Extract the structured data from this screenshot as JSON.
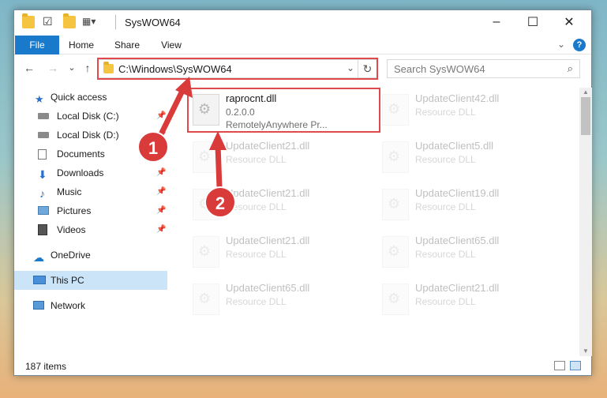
{
  "window": {
    "title": "SysWOW64",
    "minimize": "–",
    "maximize": "☐",
    "close": "✕"
  },
  "ribbon": {
    "tabs": [
      "File",
      "Home",
      "Share",
      "View"
    ],
    "expand_icon": "⌄",
    "help_icon": "?"
  },
  "navbar": {
    "back": "←",
    "forward": "→",
    "recent": "⌄",
    "up": "↑",
    "address": "C:\\Windows\\SysWOW64",
    "address_dropdown": "⌄",
    "refresh": "↻",
    "search_placeholder": "Search SysWOW64",
    "search_icon": "⌕"
  },
  "sidebar": {
    "items": [
      {
        "label": "Quick access",
        "icon": "star-icon",
        "pinned": false
      },
      {
        "label": "Local Disk (C:)",
        "icon": "drive-icon",
        "pinned": true
      },
      {
        "label": "Local Disk (D:)",
        "icon": "drive-icon",
        "pinned": true
      },
      {
        "label": "Documents",
        "icon": "documents-icon",
        "pinned": true
      },
      {
        "label": "Downloads",
        "icon": "download-icon",
        "pinned": true
      },
      {
        "label": "Music",
        "icon": "music-icon",
        "pinned": true
      },
      {
        "label": "Pictures",
        "icon": "pictures-icon",
        "pinned": true
      },
      {
        "label": "Videos",
        "icon": "videos-icon",
        "pinned": true
      },
      {
        "label": "OneDrive",
        "icon": "cloud-icon",
        "pinned": false
      },
      {
        "label": "This PC",
        "icon": "computer-icon",
        "pinned": false,
        "selected": true
      },
      {
        "label": "Network",
        "icon": "network-icon",
        "pinned": false
      }
    ]
  },
  "files": [
    {
      "name": "raprocnt.dll",
      "line2": "0.2.0.0",
      "line3": "RemotelyAnywhere Pr...",
      "highlighted": true
    },
    {
      "name": "UpdateClient42.dll",
      "line2": "Resource DLL"
    },
    {
      "name": "UpdateClient21.dll",
      "line2": "Resource DLL"
    },
    {
      "name": "UpdateClient5.dll",
      "line2": "Resource DLL"
    },
    {
      "name": "UpdateClient21.dll",
      "line2": "Resource DLL"
    },
    {
      "name": "UpdateClient19.dll",
      "line2": "Resource DLL"
    },
    {
      "name": "UpdateClient21.dll",
      "line2": "Resource DLL"
    },
    {
      "name": "UpdateClient65.dll",
      "line2": "Resource DLL"
    },
    {
      "name": "UpdateClient65.dll",
      "line2": "Resource DLL"
    },
    {
      "name": "UpdateClient21.dll",
      "line2": "Resource DLL"
    }
  ],
  "status": {
    "item_count": "187 items"
  },
  "callouts": {
    "one": "1",
    "two": "2"
  },
  "colors": {
    "accent": "#1979ca",
    "highlight": "#e04a4a",
    "callout": "#d93a3a",
    "selected": "#cce4f7"
  }
}
